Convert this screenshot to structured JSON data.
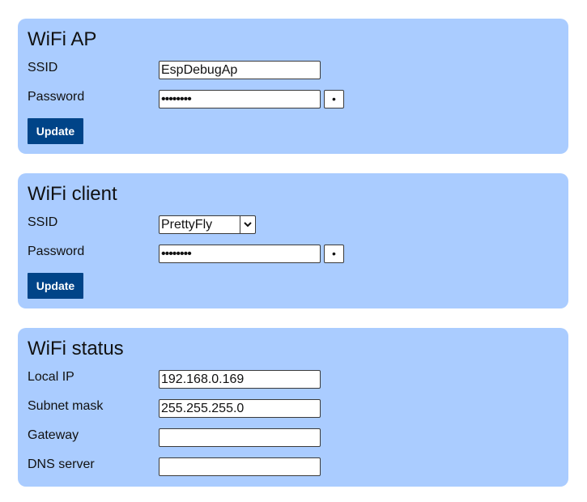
{
  "wifi_ap": {
    "title": "WiFi AP",
    "ssid_label": "SSID",
    "ssid_value": "EspDebugAp",
    "password_label": "Password",
    "password_masked": "••••••••",
    "reveal_label": "•",
    "update_label": "Update"
  },
  "wifi_client": {
    "title": "WiFi client",
    "ssid_label": "SSID",
    "ssid_selected": "PrettyFly",
    "password_label": "Password",
    "password_masked": "••••••••",
    "reveal_label": "•",
    "update_label": "Update"
  },
  "wifi_status": {
    "title": "WiFi status",
    "local_ip_label": "Local IP",
    "local_ip_value": "192.168.0.169",
    "subnet_mask_label": "Subnet mask",
    "subnet_mask_value": "255.255.255.0",
    "gateway_label": "Gateway",
    "gateway_value": "",
    "dns_server_label": "DNS server",
    "dns_server_value": ""
  },
  "colors": {
    "card_background": "#aaccff",
    "button_background": "#004488",
    "button_text": "#ffffff"
  },
  "icons": {
    "select_arrow": "chevron-down-icon"
  }
}
